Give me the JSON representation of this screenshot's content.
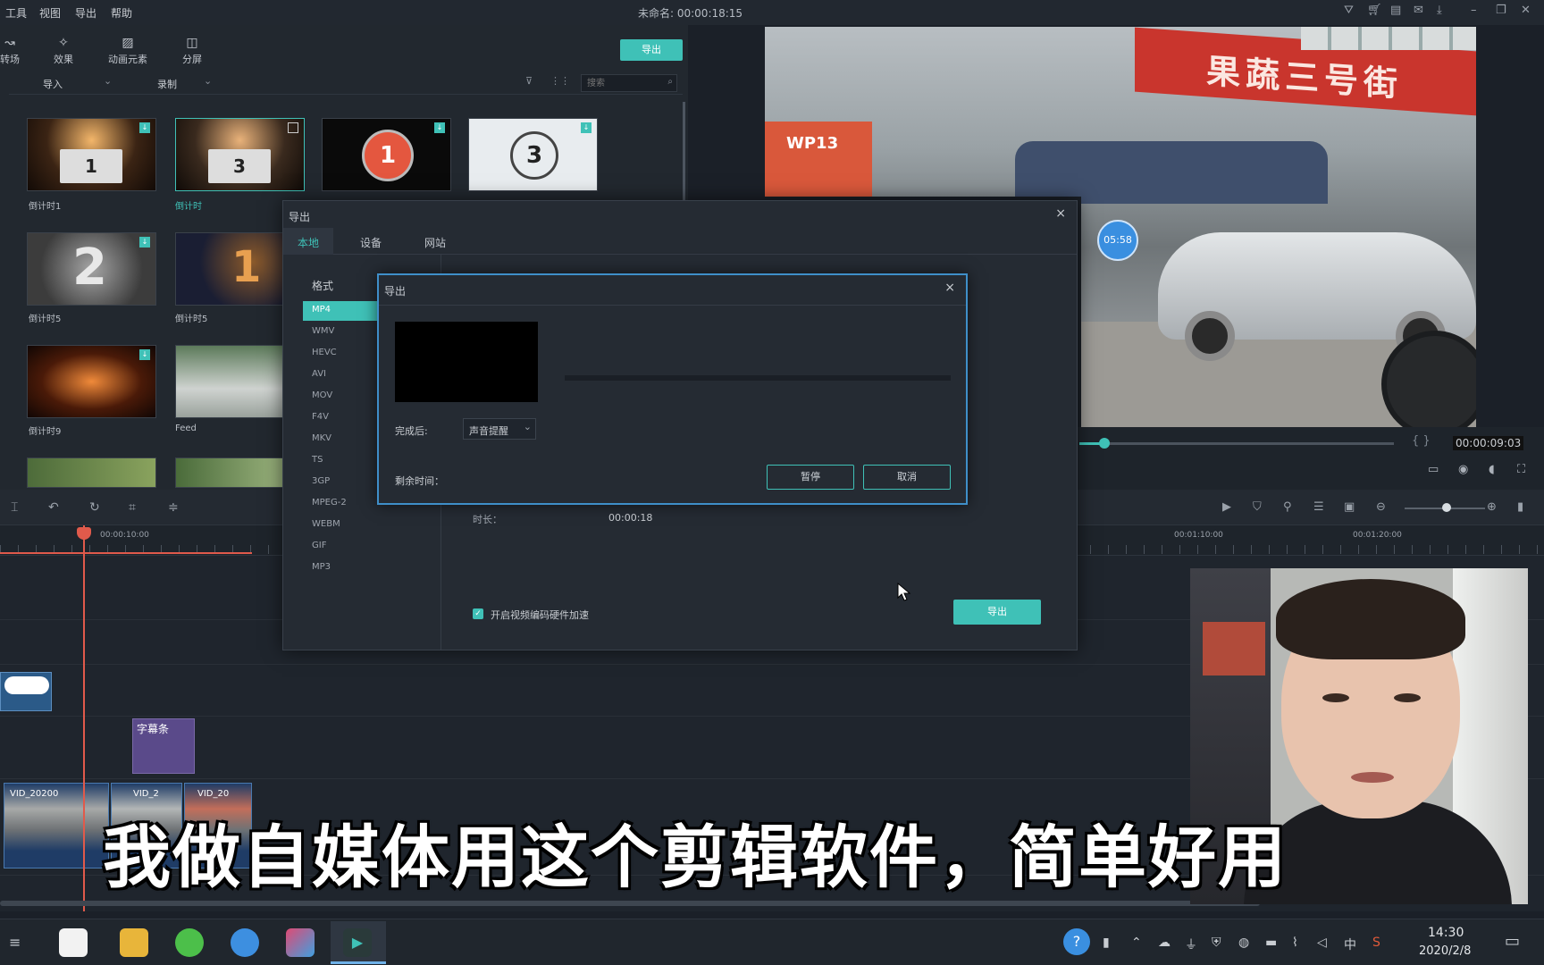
{
  "menubar": {
    "menus": [
      "工具",
      "视图",
      "导出",
      "帮助"
    ],
    "title": "未命名: 00:00:18:15"
  },
  "library": {
    "tools": [
      {
        "label": "转场",
        "icon": "transition-icon"
      },
      {
        "label": "效果",
        "icon": "effects-icon"
      },
      {
        "label": "动画元素",
        "icon": "elements-icon"
      },
      {
        "label": "分屏",
        "icon": "split-screen-icon"
      }
    ],
    "export_button": "导出",
    "import_label": "导入",
    "record_label": "录制",
    "search_placeholder": "搜索",
    "thumbnails": [
      {
        "label": "倒计时1"
      },
      {
        "label": "倒计时"
      },
      {
        "label": ""
      },
      {
        "label": ""
      },
      {
        "label": "倒计时5"
      },
      {
        "label": "倒计时5"
      },
      {
        "label": "倒计时9"
      },
      {
        "label": "Feed"
      }
    ]
  },
  "preview": {
    "shop_sign": "果蔬三号街",
    "truck_text": "WP13",
    "timer_badge": "05:58",
    "timecode": "00:00:09:03"
  },
  "timeline": {
    "ruler_labels": [
      "00:00:10:00",
      "00:01:10:00",
      "00:01:20:00"
    ],
    "title_clip": "字幕条",
    "video_clips": [
      "VID_20200",
      "VID_2",
      "VID_20"
    ]
  },
  "export_dialog": {
    "title": "导出",
    "close": "×",
    "tabs": [
      "本地",
      "设备",
      "网站"
    ],
    "format_header": "格式",
    "formats": [
      "MP4",
      "WMV",
      "HEVC",
      "AVI",
      "MOV",
      "F4V",
      "MKV",
      "TS",
      "3GP",
      "MPEG-2",
      "WEBM",
      "GIF",
      "MP3"
    ],
    "duration_label": "时长：",
    "duration_value": "00:00:18",
    "hw_accel_label": "开启视频编码硬件加速",
    "export_button": "导出"
  },
  "progress_dialog": {
    "title": "导出",
    "close": "×",
    "after_label": "完成后:",
    "after_value": "声音提醒",
    "remaining_label": "剩余时间：",
    "pause_button": "暂停",
    "cancel_button": "取消",
    "progress": 0.0
  },
  "subtitle": "我做自媒体用这个剪辑软件，简单好用",
  "taskbar": {
    "time": "14:30",
    "date": "2020/2/8",
    "ime": "中"
  }
}
